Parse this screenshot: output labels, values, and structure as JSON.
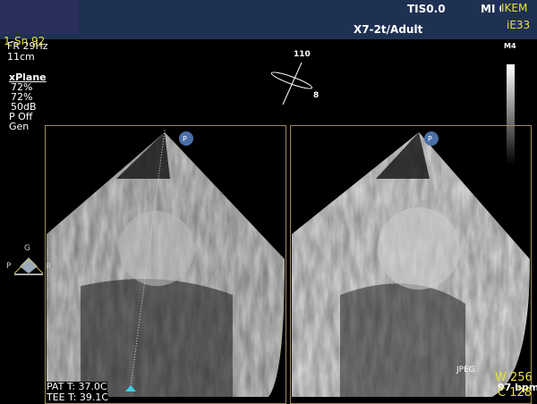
{
  "header": {
    "series": "1-Sn 92",
    "frame_rate": "FR 29Hz",
    "tis": "TIS0.0",
    "mi": "MI 0.",
    "institution": "IKEM",
    "system": "iE33",
    "probe": "X7-2t/Adult"
  },
  "left_params": {
    "depth": "11cm",
    "mode": "xPlane",
    "gain1": "72%",
    "gain2": "72%",
    "dynamic_range": "50dB",
    "persistence": "P Off",
    "resolution": "Gen"
  },
  "plane_indicator": {
    "angle_primary": "110",
    "angle_secondary": "8"
  },
  "grayscale_map": "M4",
  "orientation": {
    "top": "G",
    "left": "P",
    "right": "R"
  },
  "marker_label": "P",
  "temperatures": {
    "patient": "PAT T: 37.0C",
    "probe": "TEE T: 39.1C"
  },
  "bottom_right": {
    "format": "JPEG",
    "window": "W 256",
    "heart_rate": "97 bpm",
    "center": "C 128"
  },
  "colors": {
    "header_bg": "#1f3152",
    "overlay_text": "#e8e23a",
    "panel_border": "#a08c60",
    "marker": "#4aa8d8"
  }
}
